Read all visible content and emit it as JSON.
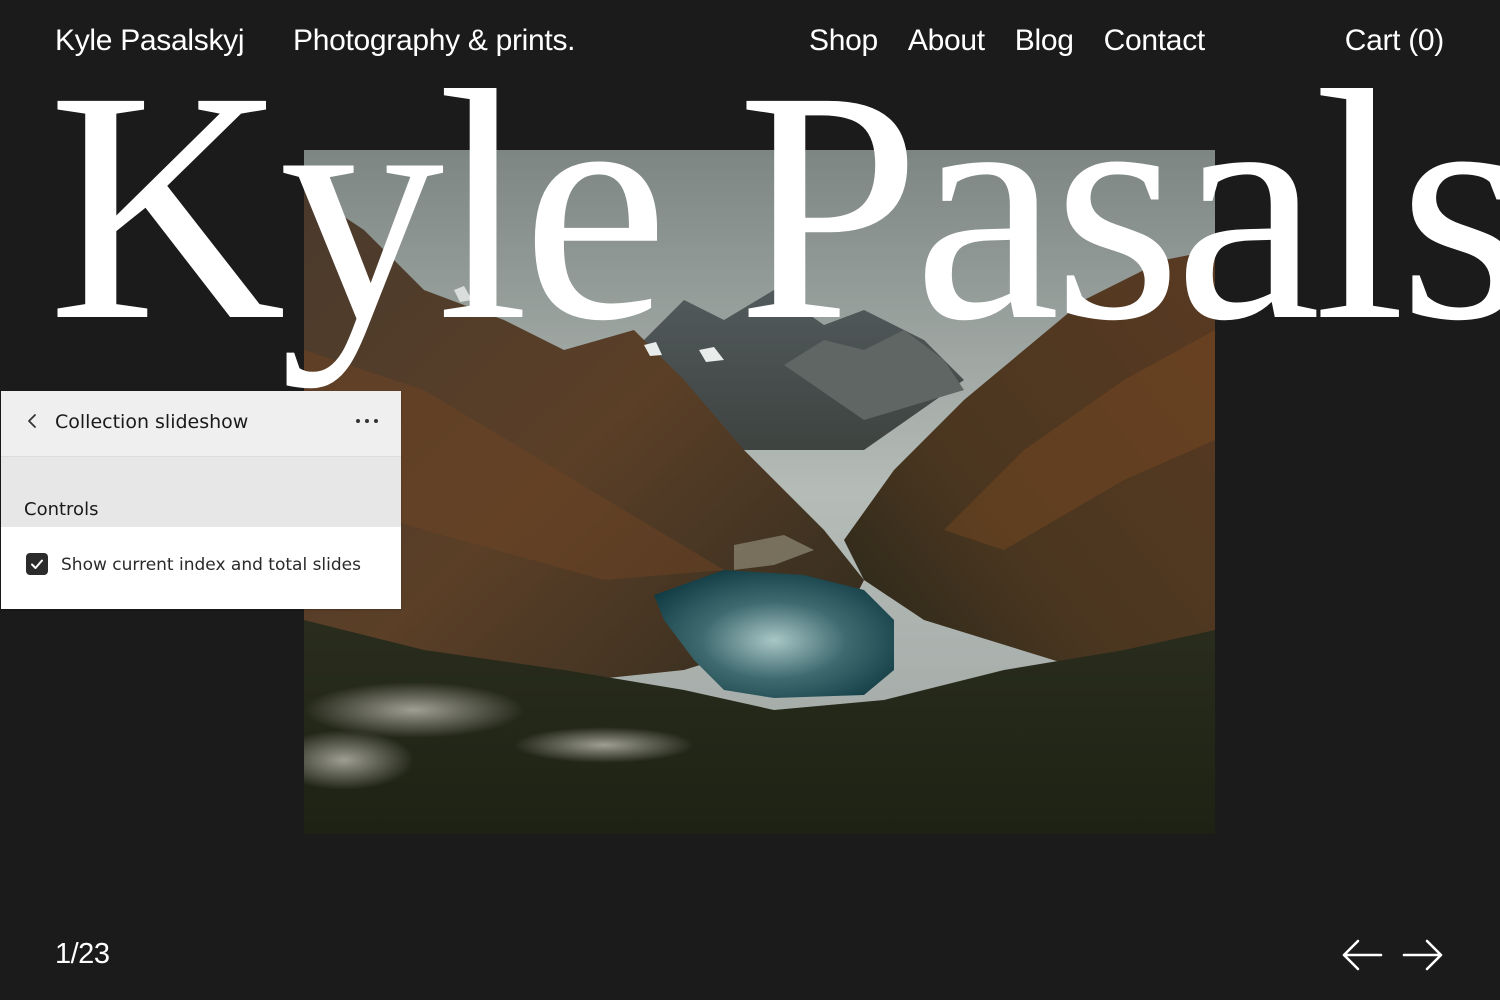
{
  "header": {
    "brand": "Kyle Pasalskyj",
    "tagline": "Photography & prints.",
    "nav": [
      "Shop",
      "About",
      "Blog",
      "Contact"
    ],
    "cart": "Cart (0)"
  },
  "hero": {
    "title": "Kyle Pasalskyj"
  },
  "panel": {
    "title": "Collection slideshow",
    "back_icon": "chevron-left-icon",
    "more_icon": "more-horizontal-icon",
    "section_title": "Controls",
    "option": {
      "label": "Show current index and total slides",
      "checked": true
    }
  },
  "slideshow": {
    "counter": "1/23",
    "prev_icon": "arrow-left-icon",
    "next_icon": "arrow-right-icon"
  },
  "colors": {
    "background": "#1b1b1b",
    "text": "#ffffff",
    "panel_header": "#efefef",
    "panel_section": "#e7e7e7",
    "checkbox": "#2b2b2b"
  }
}
